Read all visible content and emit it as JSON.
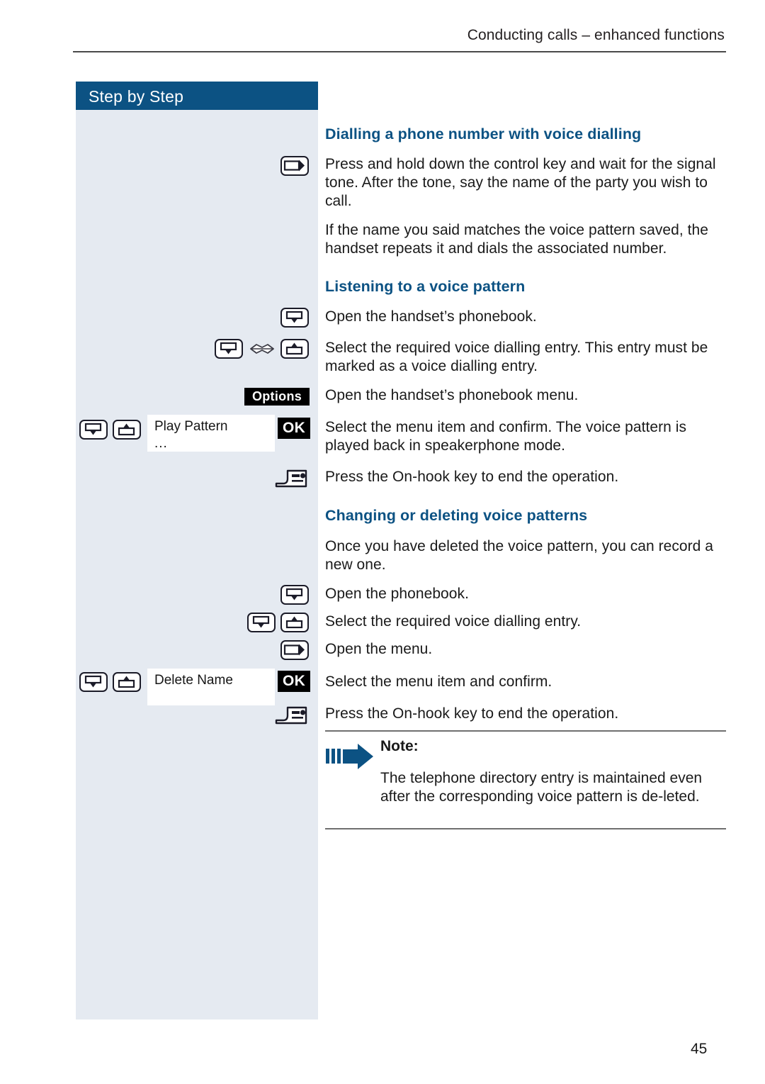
{
  "document": {
    "header": "Conducting calls – enhanced functions",
    "page_number": "45",
    "sidebar_banner": "Step by Step"
  },
  "colors": {
    "brand_blue": "#0c5283",
    "sidebar_bg": "#e5eaf1",
    "badge_bg": "#000000",
    "text": "#1a1a1a"
  },
  "sections": [
    {
      "heading": "Dialling a phone number with voice dialling",
      "paragraphs": [
        "Press and hold down the control key and wait for the signal tone. After the tone, say the name of the party you wish to call.",
        "If the name you said matches the voice pattern saved, the handset repeats it and dials the associated number."
      ]
    },
    {
      "heading": "Listening to a voice pattern",
      "paragraphs": [
        "Open the handset’s phonebook.",
        "Select the required voice dialling entry. This entry must be marked as a voice dialling entry.",
        "Open the handset’s phonebook menu.",
        "Select the menu item and confirm. The voice pattern is played back in speakerphone mode.",
        "Press the On-hook key to end the operation."
      ]
    },
    {
      "heading": "Changing or deleting voice patterns",
      "paragraphs": [
        "Once you have deleted the voice pattern, you can record a new one.",
        "Open the phonebook.",
        "Select the required voice dialling entry.",
        "Open the menu.",
        "Select the menu item and confirm.",
        "Press the On-hook key to end the operation."
      ]
    }
  ],
  "key_icons": {
    "open_menu": "control-key-right-icon",
    "scroll_down": "control-key-down-icon",
    "scroll_up": "control-key-up-icon",
    "voice_lips": "voice-lips-icon",
    "on_hook": "on-hook-key-icon"
  },
  "softkeys": {
    "options_label": "Options",
    "ok_label_play": "OK",
    "ok_label_delete": "OK"
  },
  "display_rows": [
    {
      "line1": "Play Pattern",
      "line2": "..."
    },
    {
      "line1": "Delete Name",
      "line2": ""
    }
  ],
  "note": {
    "title": "Note:",
    "text": "The telephone directory entry is maintained even after the corresponding voice pattern is de-leted."
  }
}
